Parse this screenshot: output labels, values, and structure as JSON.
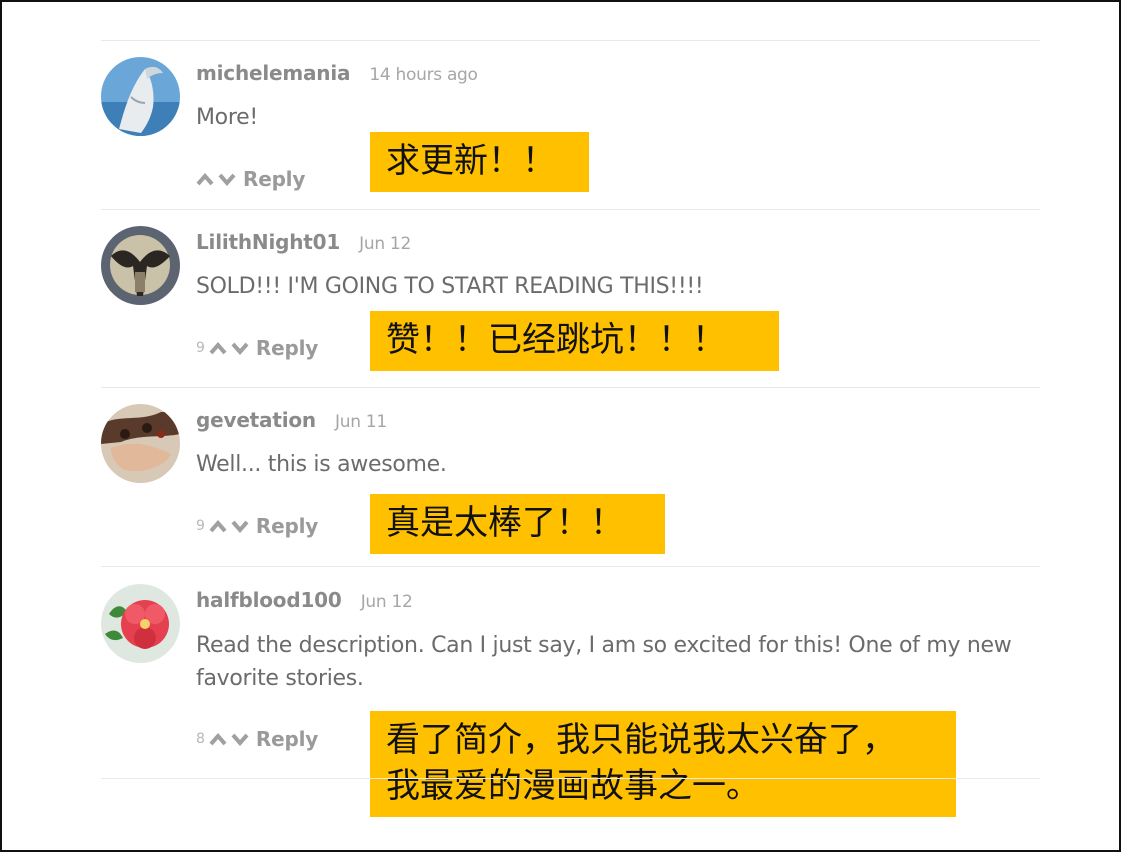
{
  "comments": [
    {
      "username": "michelemania",
      "time": "14 hours ago",
      "text": "More!",
      "votes": "",
      "reply_label": "Reply",
      "translation": "求更新！！",
      "avatar": "shark-avatar"
    },
    {
      "username": "LilithNight01",
      "time": "Jun 12",
      "text": "SOLD!!! I'M GOING TO START READING THIS!!!!",
      "votes": "9",
      "reply_label": "Reply",
      "translation": "赞！！已经跳坑！！！",
      "avatar": "dark-creature-avatar"
    },
    {
      "username": "gevetation",
      "time": "Jun 11",
      "text": "Well... this is awesome.",
      "votes": "9",
      "reply_label": "Reply",
      "translation": "真是太棒了！！",
      "avatar": "hands-avatar"
    },
    {
      "username": "halfblood100",
      "time": "Jun 12",
      "text": "Read the description. Can I just say, I am so excited for this! One of my new favorite stories.",
      "votes": "8",
      "reply_label": "Reply",
      "translation": "看了简介，我只能说我太兴奋了，\n我最爱的漫画故事之一。",
      "avatar": "flower-avatar"
    }
  ],
  "colors": {
    "highlight": "#ffc000",
    "username": "#8a8a8a",
    "body_text": "#6b6b6b",
    "divider": "#e9e9e9"
  }
}
